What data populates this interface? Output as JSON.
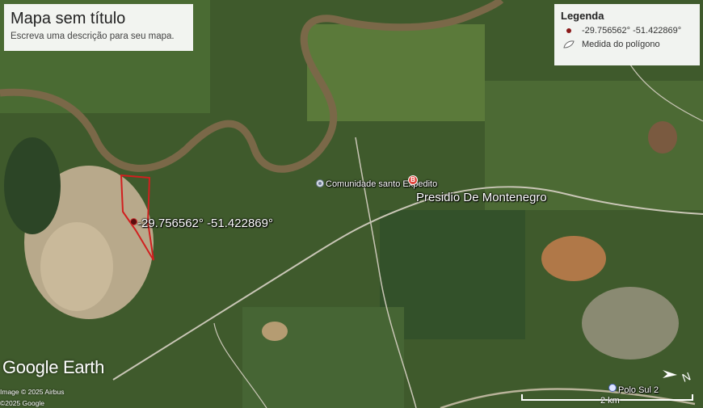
{
  "title_card": {
    "title": "Mapa sem título",
    "description": "Escreva uma descrição para seu mapa."
  },
  "legend": {
    "heading": "Legenda",
    "items": [
      {
        "icon": "point-marker-icon",
        "label": "-29.756562° -51.422869°",
        "color": "#8b1a1a"
      },
      {
        "icon": "polygon-icon",
        "label": "Medida do polígono"
      }
    ]
  },
  "places": {
    "point": "-29.756562° -51.422869°",
    "community": "Comunidade santo Expedito",
    "prison_badge": "B",
    "prison": "Presidio De Montenegro",
    "polo": "Polo Sul 2"
  },
  "branding": {
    "logo": "Google Earth",
    "image_credit": "Image © 2025 Airbus",
    "copyright": "©2025 Google"
  },
  "scale": {
    "label": "2 km"
  },
  "colors": {
    "polygon_outline": "#d11f1f",
    "marker": "#8b1a1a",
    "river": "#7a6848",
    "roads": "#c9c6b6"
  }
}
